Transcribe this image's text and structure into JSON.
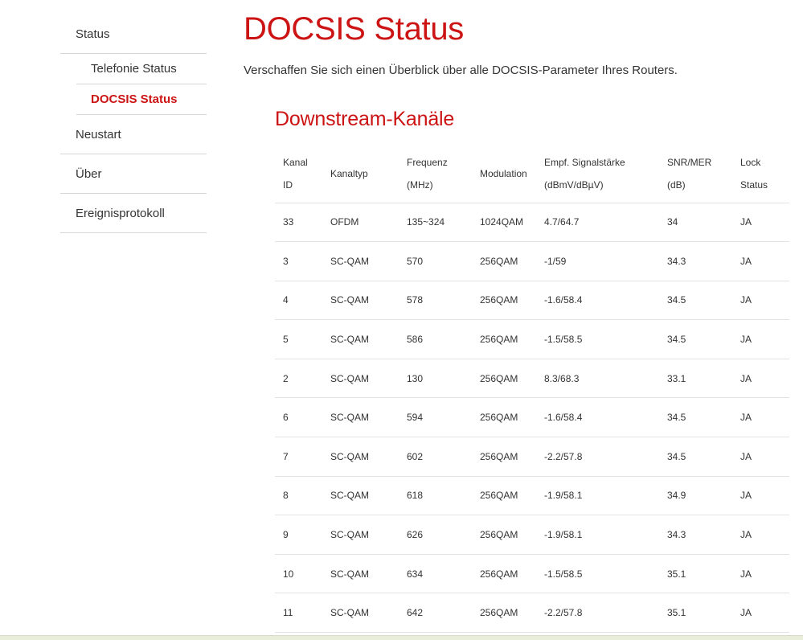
{
  "sidebar": {
    "items": [
      {
        "label": "Status",
        "level": "top",
        "active": false
      },
      {
        "label": "Telefonie Status",
        "level": "sub",
        "active": false
      },
      {
        "label": "DOCSIS Status",
        "level": "sub",
        "active": true
      },
      {
        "label": "Neustart",
        "level": "top",
        "active": false
      },
      {
        "label": "Über",
        "level": "top",
        "active": false
      },
      {
        "label": "Ereignisprotokoll",
        "level": "top",
        "active": false
      }
    ]
  },
  "page": {
    "title": "DOCSIS Status",
    "subtitle": "Verschaffen Sie sich einen Überblick über alle DOCSIS-Parameter Ihres Routers."
  },
  "downstream": {
    "title": "Downstream-Kanäle",
    "headers": [
      [
        "Kanal",
        "ID"
      ],
      [
        "Kanaltyp"
      ],
      [
        "Frequenz",
        "(MHz)"
      ],
      [
        "Modulation"
      ],
      [
        "Empf. Signalstärke",
        "(dBmV/dBµV)"
      ],
      [
        "SNR/MER",
        "(dB)"
      ],
      [
        "Lock",
        "Status"
      ]
    ],
    "rows": [
      [
        "33",
        "OFDM",
        "135~324",
        "1024QAM",
        "4.7/64.7",
        "34",
        "JA"
      ],
      [
        "3",
        "SC-QAM",
        "570",
        "256QAM",
        "-1/59",
        "34.3",
        "JA"
      ],
      [
        "4",
        "SC-QAM",
        "578",
        "256QAM",
        "-1.6/58.4",
        "34.5",
        "JA"
      ],
      [
        "5",
        "SC-QAM",
        "586",
        "256QAM",
        "-1.5/58.5",
        "34.5",
        "JA"
      ],
      [
        "2",
        "SC-QAM",
        "130",
        "256QAM",
        "8.3/68.3",
        "33.1",
        "JA"
      ],
      [
        "6",
        "SC-QAM",
        "594",
        "256QAM",
        "-1.6/58.4",
        "34.5",
        "JA"
      ],
      [
        "7",
        "SC-QAM",
        "602",
        "256QAM",
        "-2.2/57.8",
        "34.5",
        "JA"
      ],
      [
        "8",
        "SC-QAM",
        "618",
        "256QAM",
        "-1.9/58.1",
        "34.9",
        "JA"
      ],
      [
        "9",
        "SC-QAM",
        "626",
        "256QAM",
        "-1.9/58.1",
        "34.3",
        "JA"
      ],
      [
        "10",
        "SC-QAM",
        "634",
        "256QAM",
        "-1.5/58.5",
        "35.1",
        "JA"
      ],
      [
        "11",
        "SC-QAM",
        "642",
        "256QAM",
        "-2.2/57.8",
        "35.1",
        "JA"
      ]
    ]
  },
  "colors": {
    "accent": "#cc1414",
    "text": "#333333",
    "divider": "#e3e3e3"
  }
}
